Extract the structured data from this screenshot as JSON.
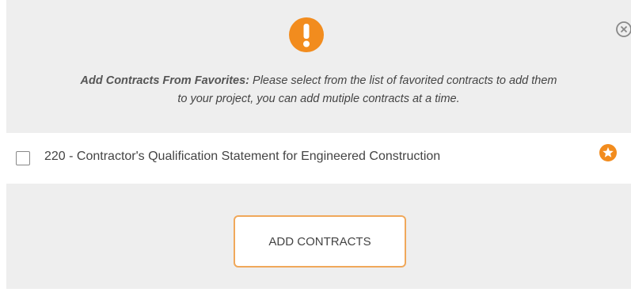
{
  "dialog": {
    "alert_icon": "exclamation-circle-icon",
    "close_icon": "close-circle-icon",
    "accent_color": "#f28c1e",
    "message": {
      "lead": "Add Contracts From Favorites:",
      "body_line1": " Please select from the list of favorited contracts to add them",
      "body_line2": "to your project, you can add mutiple contracts at a time."
    },
    "contracts": [
      {
        "label": "220 - Contractor's Qualification Statement for Engineered Construction",
        "checked": false,
        "favorite_icon": "star-circle-icon"
      }
    ],
    "add_button_label": "ADD CONTRACTS"
  }
}
